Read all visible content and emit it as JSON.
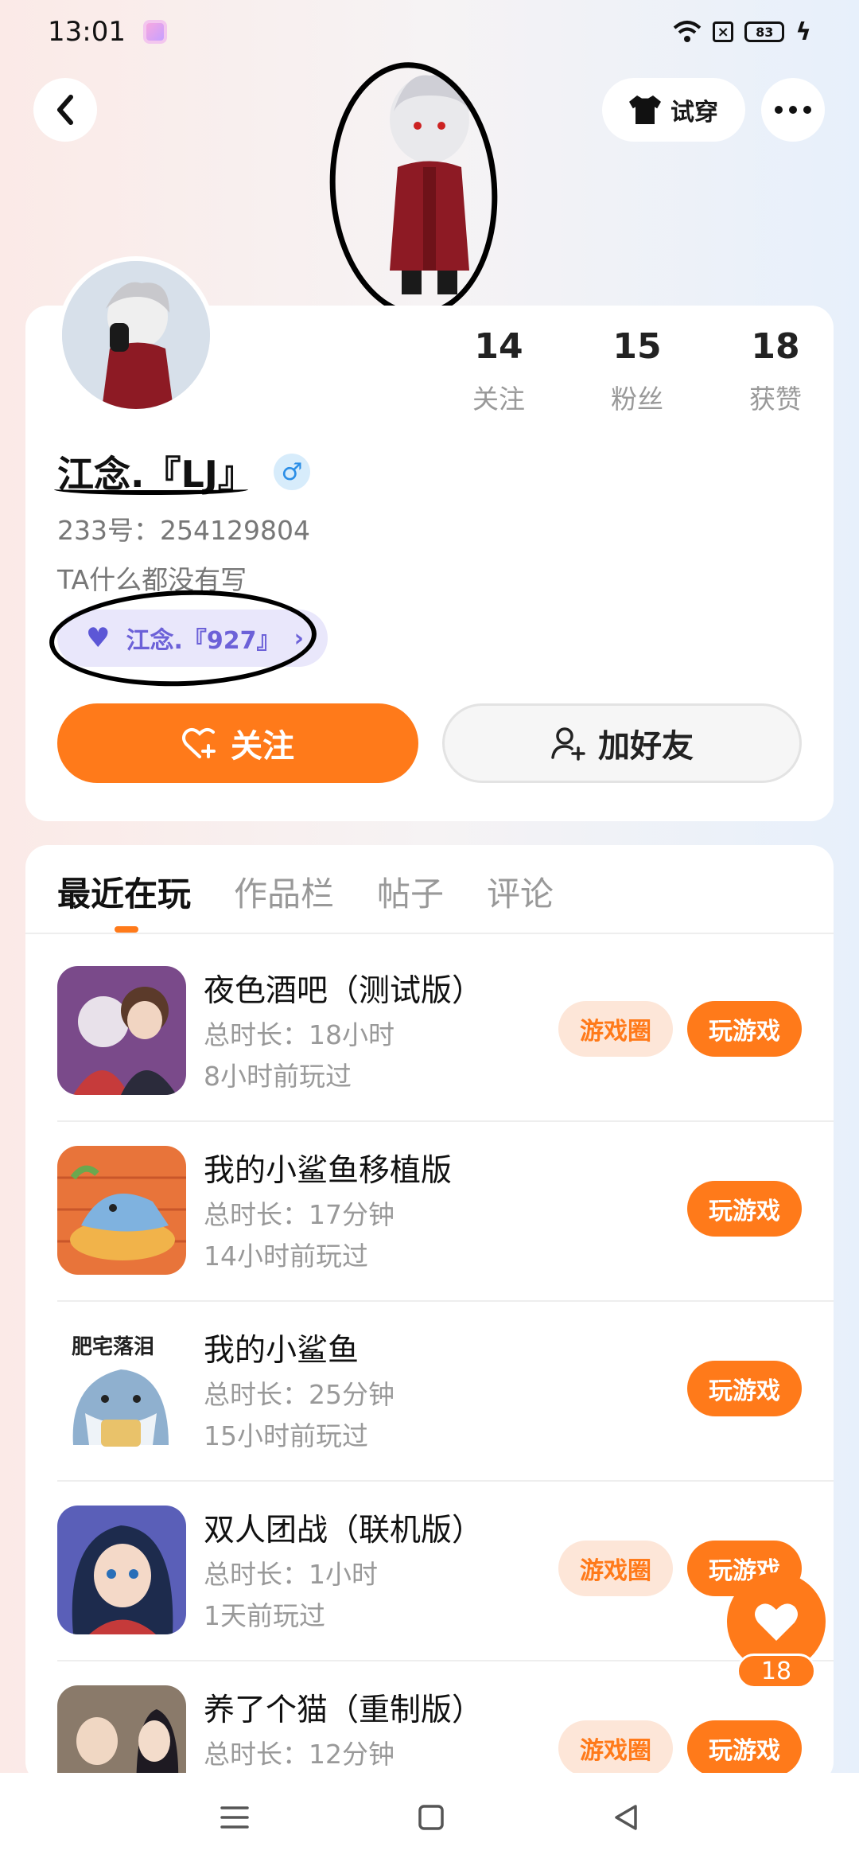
{
  "status_bar": {
    "time": "13:01",
    "battery": "83"
  },
  "header": {
    "try_on_label": "试穿"
  },
  "profile": {
    "username": "江念.『LJ』",
    "gender_symbol": "♂",
    "uid": "233号：254129804",
    "bio": "TA什么都没有写",
    "guild_name": "江念.『927』",
    "stats": [
      {
        "value": "14",
        "label": "关注"
      },
      {
        "value": "15",
        "label": "粉丝"
      },
      {
        "value": "18",
        "label": "获赞"
      }
    ],
    "follow_label": "关注",
    "add_friend_label": "加好友"
  },
  "tabs": [
    "最近在玩",
    "作品栏",
    "帖子",
    "评论"
  ],
  "games": [
    {
      "title": "夜色酒吧（测试版）",
      "duration": "总时长：18小时",
      "last_played": "8小时前玩过",
      "has_circle": true
    },
    {
      "title": "我的小鲨鱼移植版",
      "duration": "总时长：17分钟",
      "last_played": "14小时前玩过",
      "has_circle": false
    },
    {
      "title": "我的小鲨鱼",
      "duration": "总时长：25分钟",
      "last_played": "15小时前玩过",
      "has_circle": false,
      "thumb_text": "肥宅落泪"
    },
    {
      "title": "双人团战（联机版）",
      "duration": "总时长：1小时",
      "last_played": "1天前玩过",
      "has_circle": true
    },
    {
      "title": "养了个猫（重制版）",
      "duration": "总时长：12分钟",
      "last_played": "",
      "has_circle": true
    }
  ],
  "game_buttons": {
    "circle_label": "游戏圈",
    "play_label": "玩游戏"
  },
  "like_fab": {
    "count": "18"
  },
  "colors": {
    "accent": "#ff7a1a",
    "guild": "#6c61d8",
    "gender": "#2b8ee6"
  }
}
